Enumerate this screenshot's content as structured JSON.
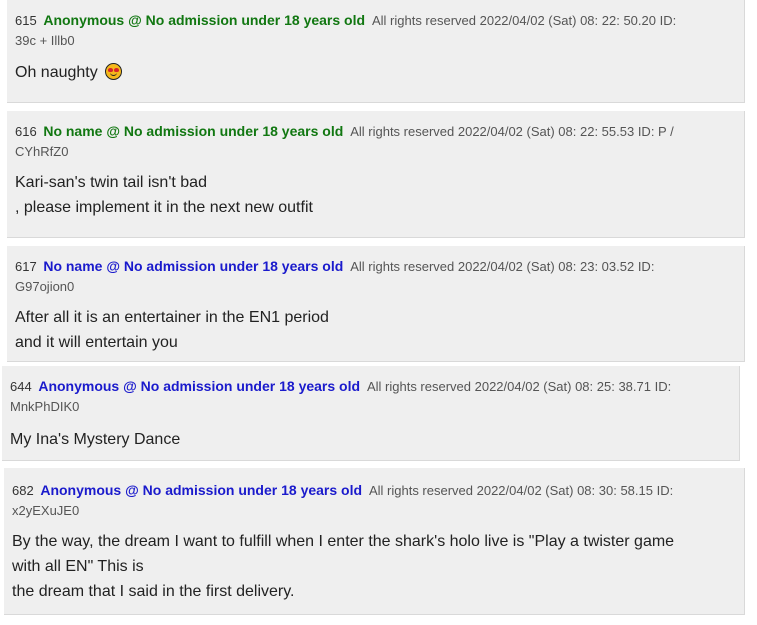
{
  "posts": [
    {
      "number": "615",
      "name": "Anonymous @ No admission under 18 years old",
      "meta_line1": "All rights reserved 2022/04/02 (Sat) 08: 22: 50.20  ID:",
      "meta_line2": "39c + Illb0",
      "body": [
        "Oh naughty"
      ],
      "emoji": "heart-eyes-emoji-icon"
    },
    {
      "number": "616",
      "name": "No name @ No admission under 18 years old",
      "meta_line1": "All rights reserved 2022/04/02 (Sat) 08: 22: 55.53  ID: P /",
      "meta_line2": "CYhRfZ0",
      "body": [
        "Kari-san's twin tail isn't bad",
        ", please implement it in the next new outfit"
      ]
    },
    {
      "number": "617",
      "name": "No name @ No admission under 18 years old",
      "meta_line1": "All rights reserved 2022/04/02 (Sat) 08: 23: 03.52  ID:",
      "meta_line2": "G97ojion0",
      "body": [
        "After all it is an entertainer in the EN1 period",
        "and it will entertain you"
      ]
    },
    {
      "number": "644",
      "name": "Anonymous @ No admission under 18 years old",
      "meta_line1": "All rights reserved 2022/04/02 (Sat) 08: 25: 38.71  ID:",
      "meta_line2": "MnkPhDIK0",
      "body": [
        "My Ina's Mystery Dance"
      ]
    },
    {
      "number": "682",
      "name": "Anonymous @ No admission under 18 years old",
      "meta_line1": "All rights reserved 2022/04/02 (Sat) 08: 30: 58.15  ID:",
      "meta_line2": "x2yEXuJE0",
      "body": [
        "By the way, the dream I want to fulfill when I enter the shark's holo live is \"Play a twister game",
        "with all EN\" This is",
        "the dream that I said in the first delivery."
      ]
    }
  ],
  "colors": {
    "name_green": "#117711",
    "name_blue": "#1a1acc",
    "post_bg": "#efefef"
  }
}
